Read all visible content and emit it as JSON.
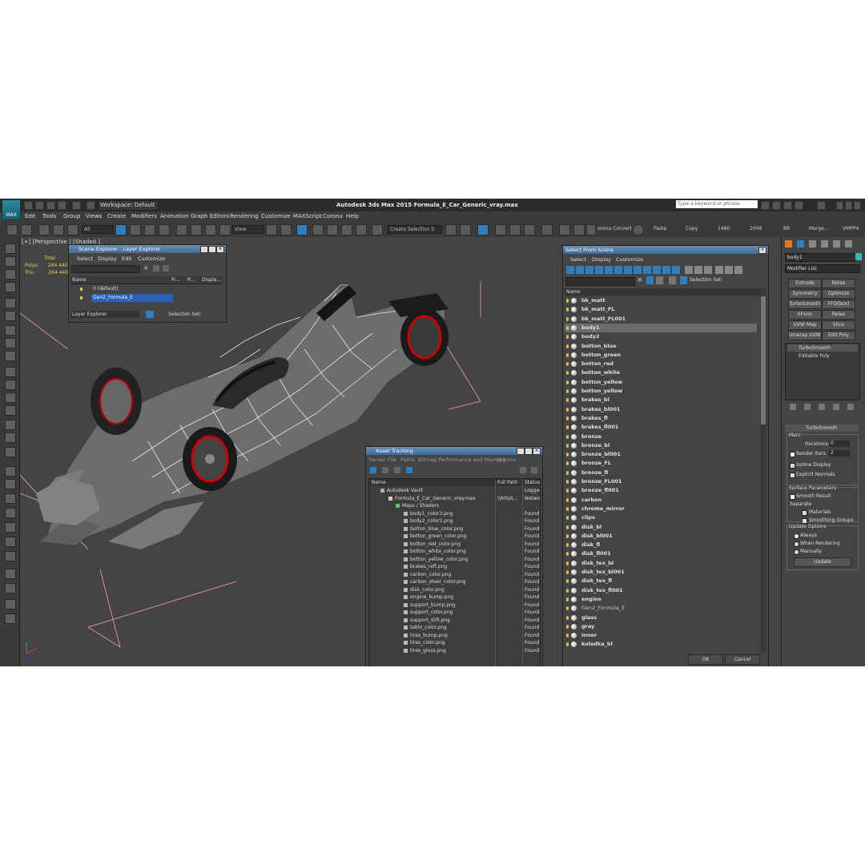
{
  "window": {
    "title": "Autodesk 3ds Max  2015    Formula_E_Car_Generic_vray.max",
    "logo_text": "MAX",
    "workspace": "Workspace: Default",
    "search_placeholder": "Type a keyword or phrase"
  },
  "menu": [
    "Edit",
    "Tools",
    "Group",
    "Views",
    "Create",
    "Modifiers",
    "Animation",
    "Graph Editors",
    "Rendering",
    "Customize",
    "MAXScript",
    "Corona",
    "Help"
  ],
  "toolbar": {
    "filter": "All",
    "view": "View",
    "selection_set": "Create Selection S",
    "corona_converter": "orona Convert",
    "paste": "Paste",
    "copy": "Copy",
    "n1480": "1480",
    "n2048": "2048",
    "br": "BR",
    "merge": "Merge...",
    "vmpp4": "VMPP4"
  },
  "viewport": {
    "label": "[+] [Perspective ] [Shaded ]",
    "stats_total": "Total",
    "polys_label": "Polys:",
    "polys_value": "264 440",
    "tris_label": "Tris:",
    "tris_value": "264 440"
  },
  "scene_explorer": {
    "title": "Scene Explorer - Layer Explorer",
    "menu": [
      "Select",
      "Display",
      "Edit",
      "Customize"
    ],
    "columns": [
      "Name",
      "Fr...",
      "R...",
      "Displa..."
    ],
    "rows": [
      "0 (default)",
      "Gen2_Formula_E"
    ],
    "footer_left": "Layer Explorer",
    "footer_right": "Selection Set:"
  },
  "asset_tracking": {
    "title": "Asset Tracking",
    "menu": [
      "Server",
      "File",
      "Paths",
      "Bitmap Performance and Memory",
      "Options"
    ],
    "columns": [
      "Name",
      "Full Path",
      "Status"
    ],
    "vault": {
      "name": "Autodesk Vault",
      "status": "Logged"
    },
    "file": {
      "name": "Formula_E_Car_Generic_vray.max",
      "path": "\\\\R0\\d\\...",
      "status": "Networ"
    },
    "group": "Maps / Shaders",
    "maps": [
      "body1_color3.png",
      "body2_color3.png",
      "botton_blue_color.png",
      "botton_green_color.png",
      "botton_red_color.png",
      "botton_white_color.png",
      "botton_yellow_color.png",
      "brakes_refl.png",
      "carbon_color.png",
      "carbon_steer_color.png",
      "disk_color.png",
      "engine_bump.png",
      "support_bump.png",
      "support_color.png",
      "support_IOR.png",
      "tablo_color.png",
      "tires_bump.png",
      "tires_color.png",
      "tires_gloss.png"
    ],
    "found": "Found"
  },
  "select_from_scene": {
    "title": "Select From Scene",
    "menu": [
      "Select",
      "Display",
      "Customize"
    ],
    "selection_set": "Selection Set:",
    "column": "Name",
    "items": [
      "bk_matt",
      "bk_matt_FL",
      "bk_matt_FL001",
      "body1",
      "body2",
      "botton_blue",
      "botton_green",
      "botton_red",
      "botton_white",
      "botton_yellow",
      "botton_yellow",
      "brakes_bl",
      "brakes_bl001",
      "brakes_fl",
      "brakes_fl001",
      "bronze",
      "bronze_bl",
      "bronze_bl001",
      "bronze_FL",
      "bronze_fl",
      "bronze_FL001",
      "bronze_fl001",
      "carbon",
      "chrome_mirror",
      "clips",
      "disk_bl",
      "disk_bl001",
      "disk_fl",
      "disk_fl001",
      "disk_tex_bl",
      "disk_tex_bl001",
      "disk_tex_fl",
      "disk_tex_fl001",
      "engine",
      "Gen2_Formula_E",
      "glass",
      "gray",
      "inner",
      "kolodka_bl"
    ],
    "selected_index": 3,
    "ok": "OK",
    "cancel": "Cancel"
  },
  "command_panel": {
    "object_name": "body1",
    "modifier_list": "Modifier List",
    "buttons": [
      "Extrude",
      "Noise",
      "Symmetry",
      "Optimize",
      "TurboSmooth",
      "FFD(box)",
      "XForm",
      "Relax",
      "UVW Map",
      "Slice",
      "Unwrap UVW",
      "Edit Poly"
    ],
    "stack": [
      "TurboSmooth",
      "Editable Poly"
    ],
    "rollout_title": "TurboSmooth",
    "main": "Main",
    "iterations_label": "Iterations:",
    "iterations": "0",
    "render_iters_label": "Render Iters:",
    "render_iters": "2",
    "isoline": "Isoline Display",
    "explicit": "Explicit Normals",
    "surface_params": "Surface Parameters",
    "smooth_result": "Smooth Result",
    "separate": "Separate",
    "materials": "Materials",
    "smoothing_groups": "Smoothing Groups",
    "update_options": "Update Options",
    "always": "Always",
    "when_rendering": "When Rendering",
    "manually": "Manually",
    "update": "Update"
  }
}
